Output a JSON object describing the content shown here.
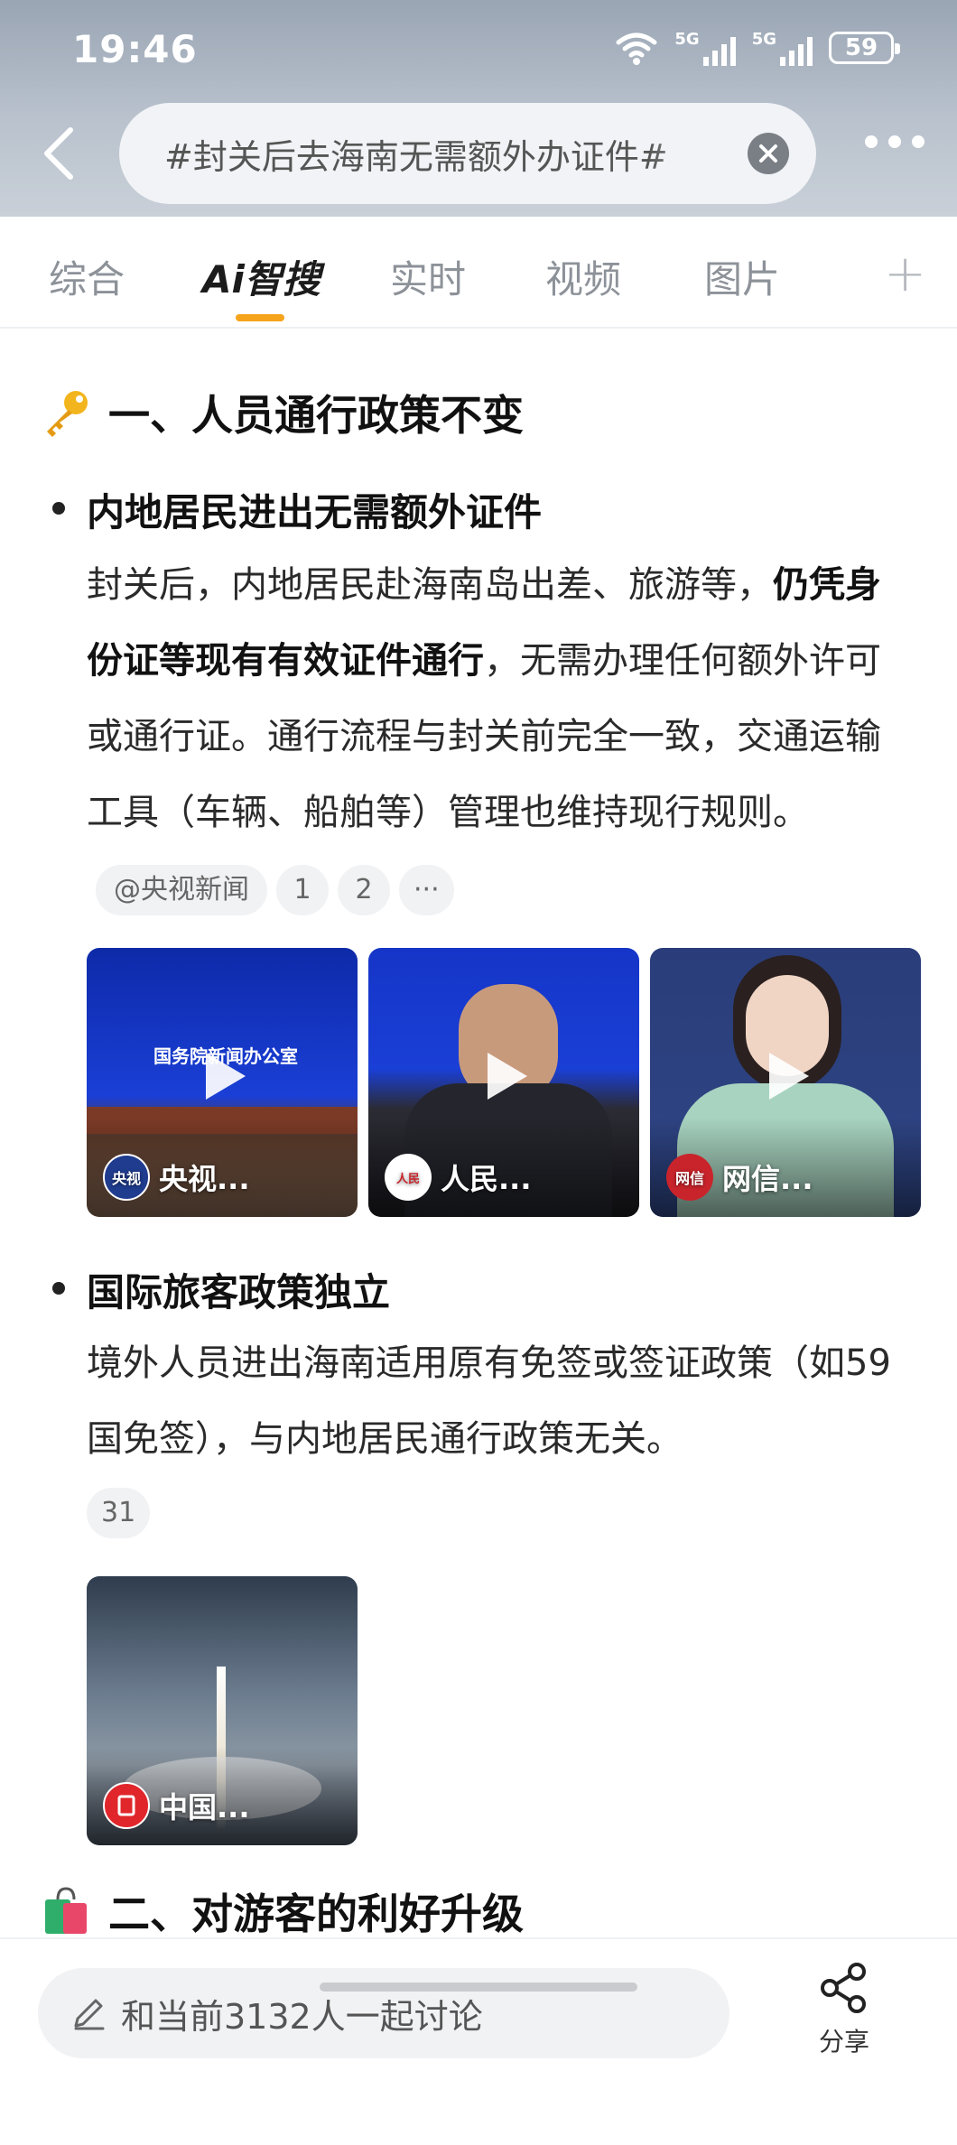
{
  "status_bar": {
    "time": "19:46",
    "net1": "5G",
    "net2": "5G",
    "battery": "59"
  },
  "search": {
    "query": "#封关后去海南无需额外办证件#"
  },
  "tabs": [
    {
      "label": "综合",
      "active": false
    },
    {
      "label": "Ai智搜",
      "active": true
    },
    {
      "label": "实时",
      "active": false
    },
    {
      "label": "视频",
      "active": false
    },
    {
      "label": "图片",
      "active": false
    }
  ],
  "tabs_plus": "+",
  "section1": {
    "icon": "key-icon",
    "title": "一、人员通行政策不变",
    "item1": {
      "heading": "内地居民进出无需额外证件",
      "text_1": "封关后，内地居民赴海南岛出差、旅游等，",
      "text_bold": "仍凭身份证等现有有效证件通行",
      "text_2": "，无需办理任何额外许可或通行证。通行流程与封关前完全一致，交通运输工具（车辆、船舶等）管理也维持现行规则。",
      "source_chip": "@央视新闻",
      "ref_chips": [
        "1",
        "2"
      ],
      "more_chip": "···"
    },
    "videos": [
      {
        "source": "央视...",
        "logo_text": "央视\n新闻",
        "logo_color": "#1f3c8f",
        "bg_text": "国务院新闻办公室"
      },
      {
        "source": "人民...",
        "logo_text": "人民日报",
        "logo_color": "#ffffff",
        "bg_text": ""
      },
      {
        "source": "网信...",
        "logo_text": "网信",
        "logo_color": "#c9242b",
        "bg_text": ""
      }
    ],
    "item2": {
      "heading": "国际旅客政策独立",
      "text": "境外人员进出海南适用原有免签或签证政策（如59国免签），与内地居民通行政策无关。",
      "ref_chip": "31"
    },
    "image": {
      "source": "中国...",
      "logo_color": "#e0262b"
    }
  },
  "section2": {
    "icon": "shopping-bag-icon",
    "title": "二、对游客的利好升级"
  },
  "bottom": {
    "discuss_placeholder": "和当前3132人一起讨论",
    "share_label": "分享"
  },
  "colors": {
    "accent": "#f7a41d",
    "header_bg": "#a9b3c0"
  }
}
